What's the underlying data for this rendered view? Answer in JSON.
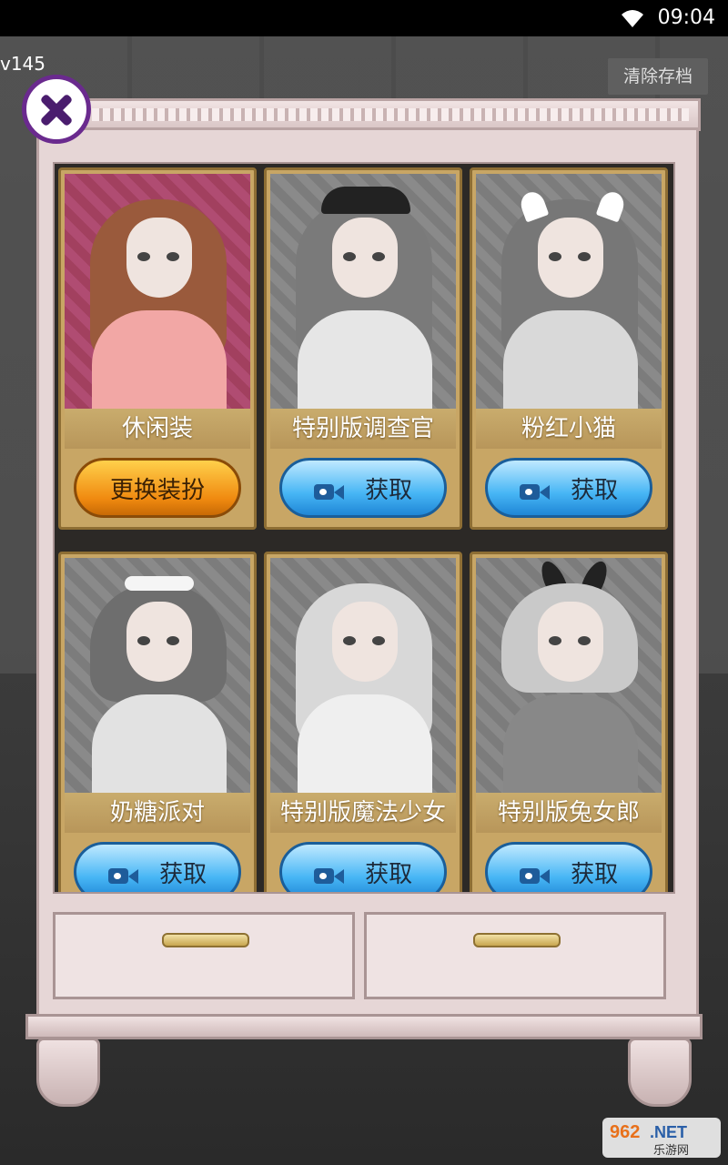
{
  "status_bar": {
    "time": "09:04"
  },
  "hud": {
    "version": "v145",
    "clear_save_label": "清除存档"
  },
  "outfits": [
    {
      "name": "休闲装",
      "action_label": "更换装扮",
      "unlocked": true,
      "hair_color": "#9a5a3c",
      "body_color": "#f2a7a5"
    },
    {
      "name": "特别版调查官",
      "action_label": "获取",
      "unlocked": false,
      "hair_color": "#7a7a7a",
      "body_color": "#e6e6e6"
    },
    {
      "name": "粉红小猫",
      "action_label": "获取",
      "unlocked": false,
      "hair_color": "#777",
      "body_color": "#d9d9d9"
    },
    {
      "name": "奶糖派对",
      "action_label": "获取",
      "unlocked": false,
      "hair_color": "#6e6e6e",
      "body_color": "#e2e2e2"
    },
    {
      "name": "特别版魔法少女",
      "action_label": "获取",
      "unlocked": false,
      "hair_color": "#d8d8d8",
      "body_color": "#efefef"
    },
    {
      "name": "特别版兔女郎",
      "action_label": "获取",
      "unlocked": false,
      "hair_color": "#c9c9c9",
      "body_color": "#888"
    }
  ],
  "watermark_text": "962.NET 乐游网"
}
